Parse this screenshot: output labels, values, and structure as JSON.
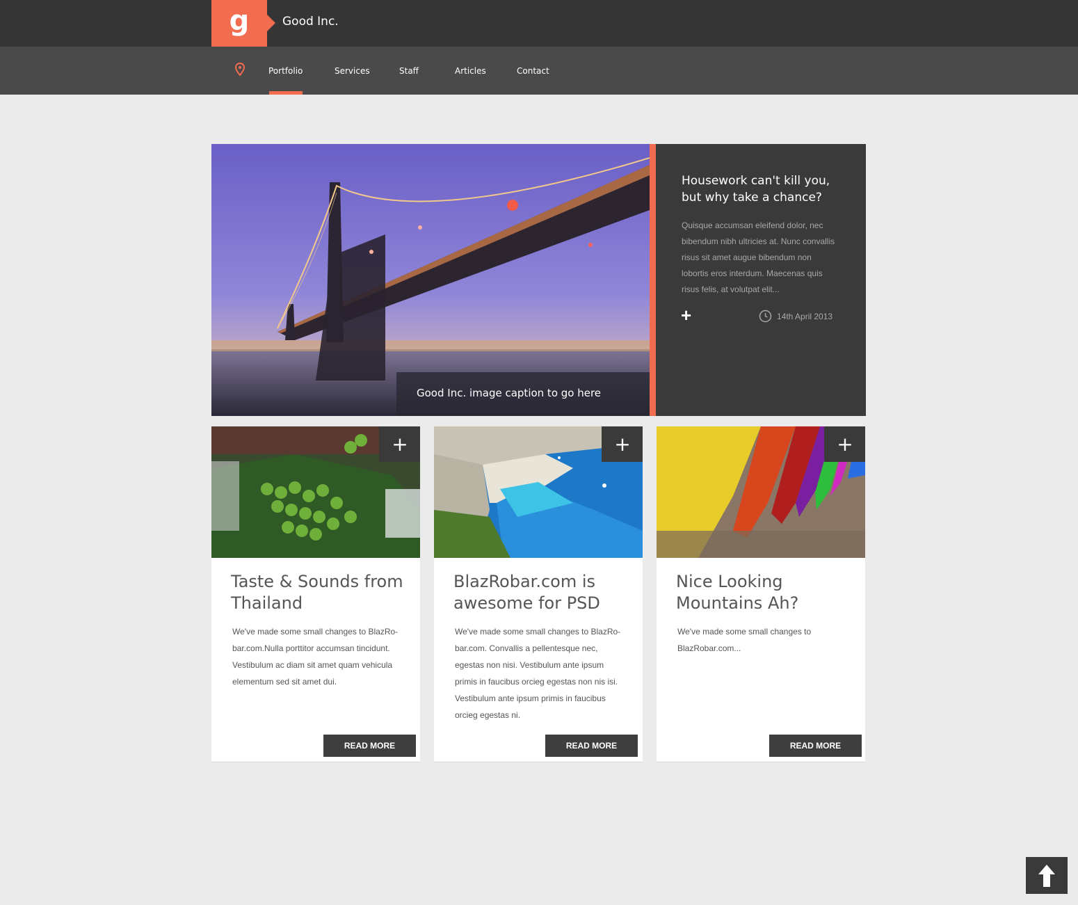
{
  "header": {
    "logo_letter": "g",
    "brand": "Good Inc."
  },
  "nav": {
    "items": [
      {
        "label": "Portfolio",
        "active": true
      },
      {
        "label": "Services",
        "active": false
      },
      {
        "label": "Staff",
        "active": false
      },
      {
        "label": "Articles",
        "active": false
      },
      {
        "label": "Contact",
        "active": false
      }
    ],
    "accent_color": "#f26c4f"
  },
  "hero": {
    "image": "bridge-at-dusk",
    "caption": "Good Inc. image caption to go here",
    "title": "Housework can't kill you, but why take a chance?",
    "text": "Quisque accumsan eleifend dolor, nec bibendum nibh ultricies at. Nunc convallis risus sit amet augue bibendum non lobortis eros interdum. Maecenas quis risus felis, at volutpat elit...",
    "plus": "+",
    "date": "14th April 2013"
  },
  "cards": [
    {
      "image": "market-limes",
      "title": "Taste & Sounds from Thailand",
      "text": "We've made some small changes to BlazRo-bar.com.Nulla porttitor accumsan tincidunt. Vestibulum ac diam sit amet quam vehicula elementum sed sit amet dui.",
      "button": "READ MORE",
      "plus": "+"
    },
    {
      "image": "turquoise-beach",
      "title": "BlazRobar.com is awesome for PSD",
      "text": "We've made some small changes to BlazRo-bar.com. Convallis a pellentesque nec, egestas non nisi. Vestibulum ante ipsum primis in faucibus orcieg egestas non nis isi. Vestibulum ante ipsum primis in faucibus orcieg egestas ni.",
      "button": "READ MORE",
      "plus": "+"
    },
    {
      "image": "colored-crayons",
      "title": "Nice Looking Mountains Ah?",
      "text": "We've made some small changes to BlazRobar.com...",
      "button": "READ MORE",
      "plus": "+"
    }
  ],
  "back_to_top": "up-arrow-icon"
}
